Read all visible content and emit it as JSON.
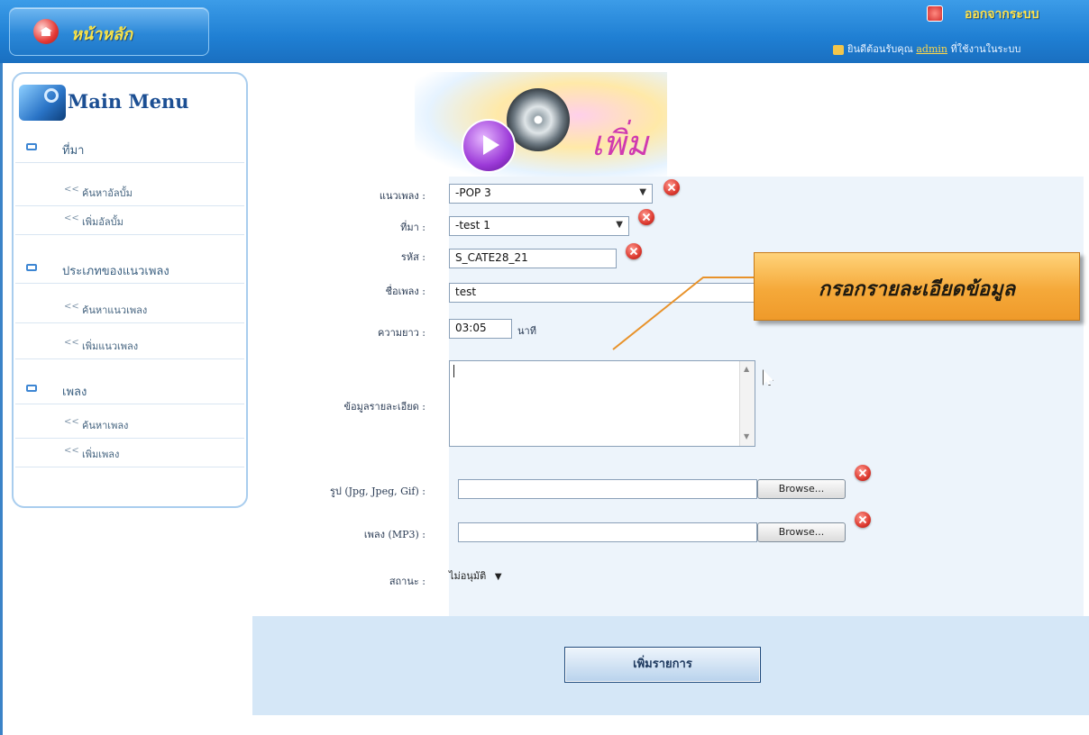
{
  "header": {
    "home_label": "หน้าหลัก",
    "logout_label": "ออกจากระบบ",
    "welcome_prefix": "ยินดีต้อนรับคุณ",
    "user": "admin",
    "welcome_suffix": "ที่ใช้งานในระบบ"
  },
  "sidebar": {
    "title": "Main Menu",
    "groups": [
      {
        "label": "ที่มา",
        "items": [
          {
            "label": "ค้นหาอัลบั้ม"
          },
          {
            "label": "เพิ่มอัลบั้ม"
          }
        ]
      },
      {
        "label": "ประเภทของแนวเพลง",
        "items": [
          {
            "label": "ค้นหาแนวเพลง"
          },
          {
            "label": "เพิ่มแนวเพลง"
          }
        ]
      },
      {
        "label": "เพลง",
        "items": [
          {
            "label": "ค้นหาเพลง"
          },
          {
            "label": "เพิ่มเพลง"
          }
        ]
      }
    ]
  },
  "banner": {
    "title": "เพิ่ม"
  },
  "form": {
    "genre": {
      "label": "แนวเพลง :",
      "value": "-POP 3"
    },
    "source": {
      "label": "ที่มา :",
      "value": "-test 1"
    },
    "code": {
      "label": "รหัส :",
      "value": "S_CATE28_21"
    },
    "song_name": {
      "label": "ชื่อเพลง :",
      "value": "test"
    },
    "duration": {
      "label": "ความยาว :",
      "value": "03:05",
      "unit": "นาที"
    },
    "detail": {
      "label": "ข้อมูลรายละเอียด :",
      "value": ""
    },
    "image": {
      "label": "รูป (Jpg, Jpeg, Gif) :",
      "button": "Browse..."
    },
    "song_file": {
      "label": "เพลง (MP3) :",
      "button": "Browse..."
    },
    "status": {
      "label": "สถานะ :",
      "value": "ไม่อนุมัติ"
    },
    "submit_label": "เพิ่มรายการ"
  },
  "callout": {
    "text": "กรอกรายละเอียดข้อมูล"
  },
  "colors": {
    "header": "#1f7fd3",
    "accent": "#f5a93a",
    "form_bg": "#edf4fb",
    "action_bar": "#d5e7f7"
  }
}
